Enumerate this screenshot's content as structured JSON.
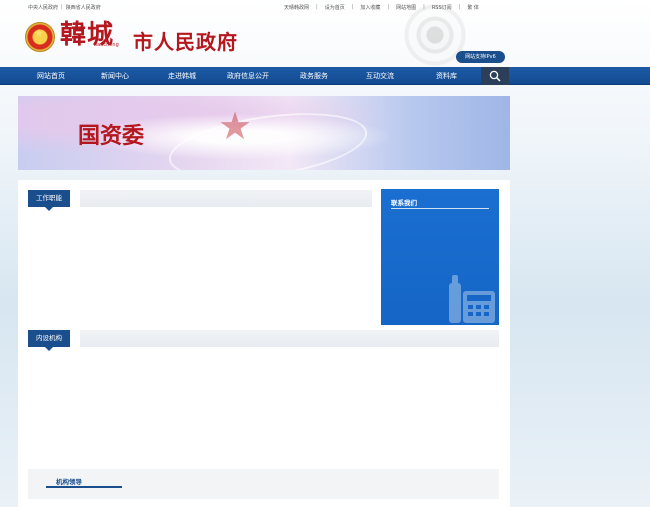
{
  "top_links_left": [
    "中央人民政府",
    "陕西省人民政府"
  ],
  "top_links_right": [
    "天晴韩政网",
    "设为首页",
    "加入收藏",
    "网站地图",
    "RSS订阅",
    "繁 体"
  ],
  "header": {
    "logo_main": "韓城",
    "logo_pinyin": "hancheng",
    "logo_rest": "市人民政府",
    "ipv6_label": "网站支持IPv6"
  },
  "nav": {
    "items": [
      "网站首页",
      "新闻中心",
      "走进韩城",
      "政府信息公开",
      "政务服务",
      "互动交流",
      "资料库"
    ],
    "search_icon": "search-icon"
  },
  "banner": {
    "title": "国资委"
  },
  "sections": {
    "duties": "工作职能",
    "contact": "联系我们",
    "internal": "内设机构",
    "leaders": "机构领导"
  },
  "colors": {
    "nav_blue": "#1a4e8c",
    "contact_blue": "#1565c6",
    "brand_red": "#b5171f"
  }
}
